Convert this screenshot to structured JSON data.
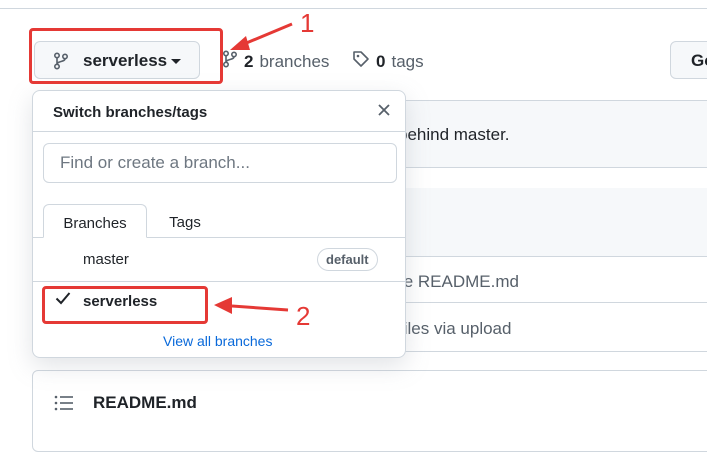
{
  "branch_selector": {
    "current_branch": "serverless"
  },
  "repo_meta": {
    "branches_count": "2",
    "branches_label": "branches",
    "tags_count": "0",
    "tags_label": "tags"
  },
  "go_button": {
    "label": "Go"
  },
  "background": {
    "status_text_fragment": "behind master.",
    "commit_messages": [
      "te README.md",
      "files via upload"
    ],
    "readme_title": "README.md"
  },
  "dropdown": {
    "title": "Switch branches/tags",
    "search_placeholder": "Find or create a branch...",
    "tabs": [
      {
        "label": "Branches",
        "active": true
      },
      {
        "label": "Tags",
        "active": false
      }
    ],
    "branches": [
      {
        "name": "master",
        "badge": "default",
        "selected": false
      },
      {
        "name": "serverless",
        "badge": "",
        "selected": true
      }
    ],
    "view_all_label": "View all branches"
  },
  "annotations": {
    "label_1": "1",
    "label_2": "2",
    "color": "#e53935"
  },
  "colors": {
    "link": "#0969da",
    "border": "#d0d7de",
    "text": "#1f2328",
    "muted": "#57606a"
  }
}
